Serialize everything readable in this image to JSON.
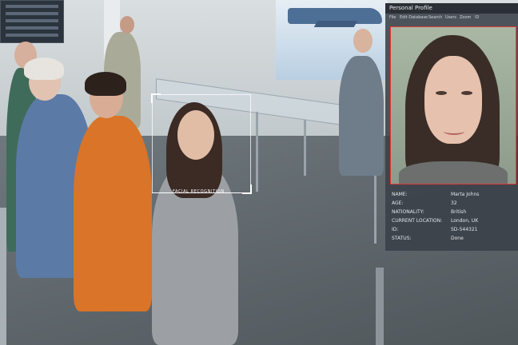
{
  "overlay": {
    "scan_label": "FACIAL RECOGNITION"
  },
  "profile_window": {
    "title": "Personal Profile",
    "menu": [
      "File",
      "Edit Database",
      "Search",
      "Users",
      "Zoom",
      "ID"
    ],
    "fields": [
      {
        "label": "NAME:",
        "value": "Marta Johns"
      },
      {
        "label": "AGE:",
        "value": "32"
      },
      {
        "label": "NATIONALITY:",
        "value": "British"
      },
      {
        "label": "CURRENT LOCATION:",
        "value": "London, UK"
      },
      {
        "label": "ID:",
        "value": "SD-544321"
      },
      {
        "label": "STATUS:",
        "value": "Done"
      }
    ],
    "photo_border_color": "#e03a3a"
  }
}
